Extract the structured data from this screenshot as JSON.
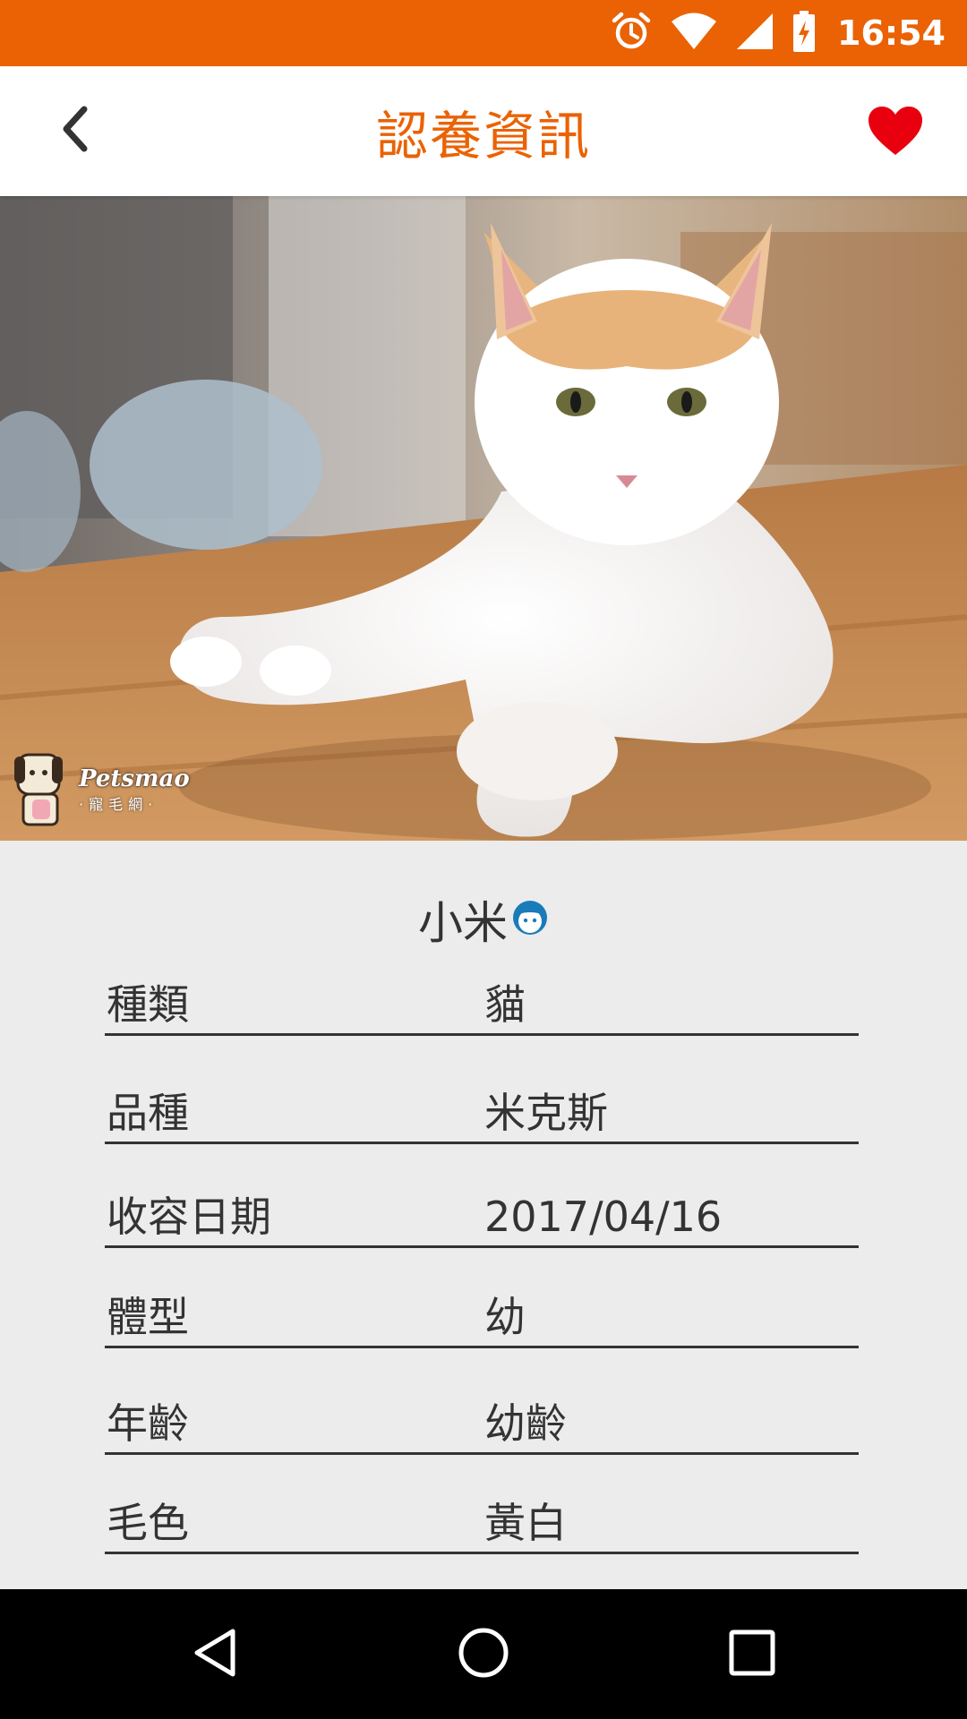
{
  "status_bar": {
    "time": "16:54",
    "icons": [
      "alarm-icon",
      "wifi-icon",
      "signal-icon",
      "battery-charging-icon"
    ],
    "background": "#ea6204"
  },
  "app_bar": {
    "title": "認養資訊",
    "back_icon": "chevron-left-icon",
    "favorite_icon": "heart-icon",
    "title_color": "#ea6204",
    "favorite_color": "#e8000f"
  },
  "hero": {
    "subject": "white and orange kitten lying on a wooden floor",
    "watermark": {
      "brand": "Petsmao",
      "sub": "·寵毛網·"
    }
  },
  "pet": {
    "name": "小米",
    "gender_icon": "male-face-icon",
    "gender_color": "#1a7bb9"
  },
  "info": [
    {
      "label": "種類",
      "value": "貓"
    },
    {
      "label": "品種",
      "value": "米克斯"
    },
    {
      "label": "收容日期",
      "value": "2017/04/16"
    },
    {
      "label": "體型",
      "value": "幼"
    },
    {
      "label": "年齡",
      "value": "幼齡"
    },
    {
      "label": "毛色",
      "value": "黃白"
    }
  ],
  "nav_bar": {
    "buttons": [
      "back-triangle-icon",
      "home-circle-icon",
      "recents-square-icon"
    ]
  }
}
